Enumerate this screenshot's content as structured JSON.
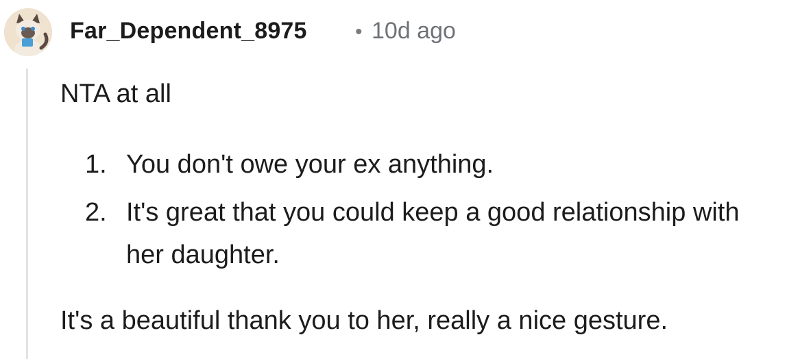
{
  "comment": {
    "author": "Far_Dependent_8975",
    "separator": "•",
    "timestamp": "10d ago",
    "body": {
      "intro": "NTA at all",
      "list": [
        {
          "number": "1.",
          "text": "You don't owe your ex anything."
        },
        {
          "number": "2.",
          "text": "It's great that you could keep a good relationship with her daughter."
        }
      ],
      "closing": "It's a beautiful thank you to her, really a nice gesture."
    }
  },
  "avatar": {
    "icon": "siamese-cat-avatar-icon",
    "background": "#efe2cf"
  },
  "colors": {
    "text": "#1c1c1c",
    "muted": "#6f7378",
    "thread_line": "#e3e3e3"
  }
}
